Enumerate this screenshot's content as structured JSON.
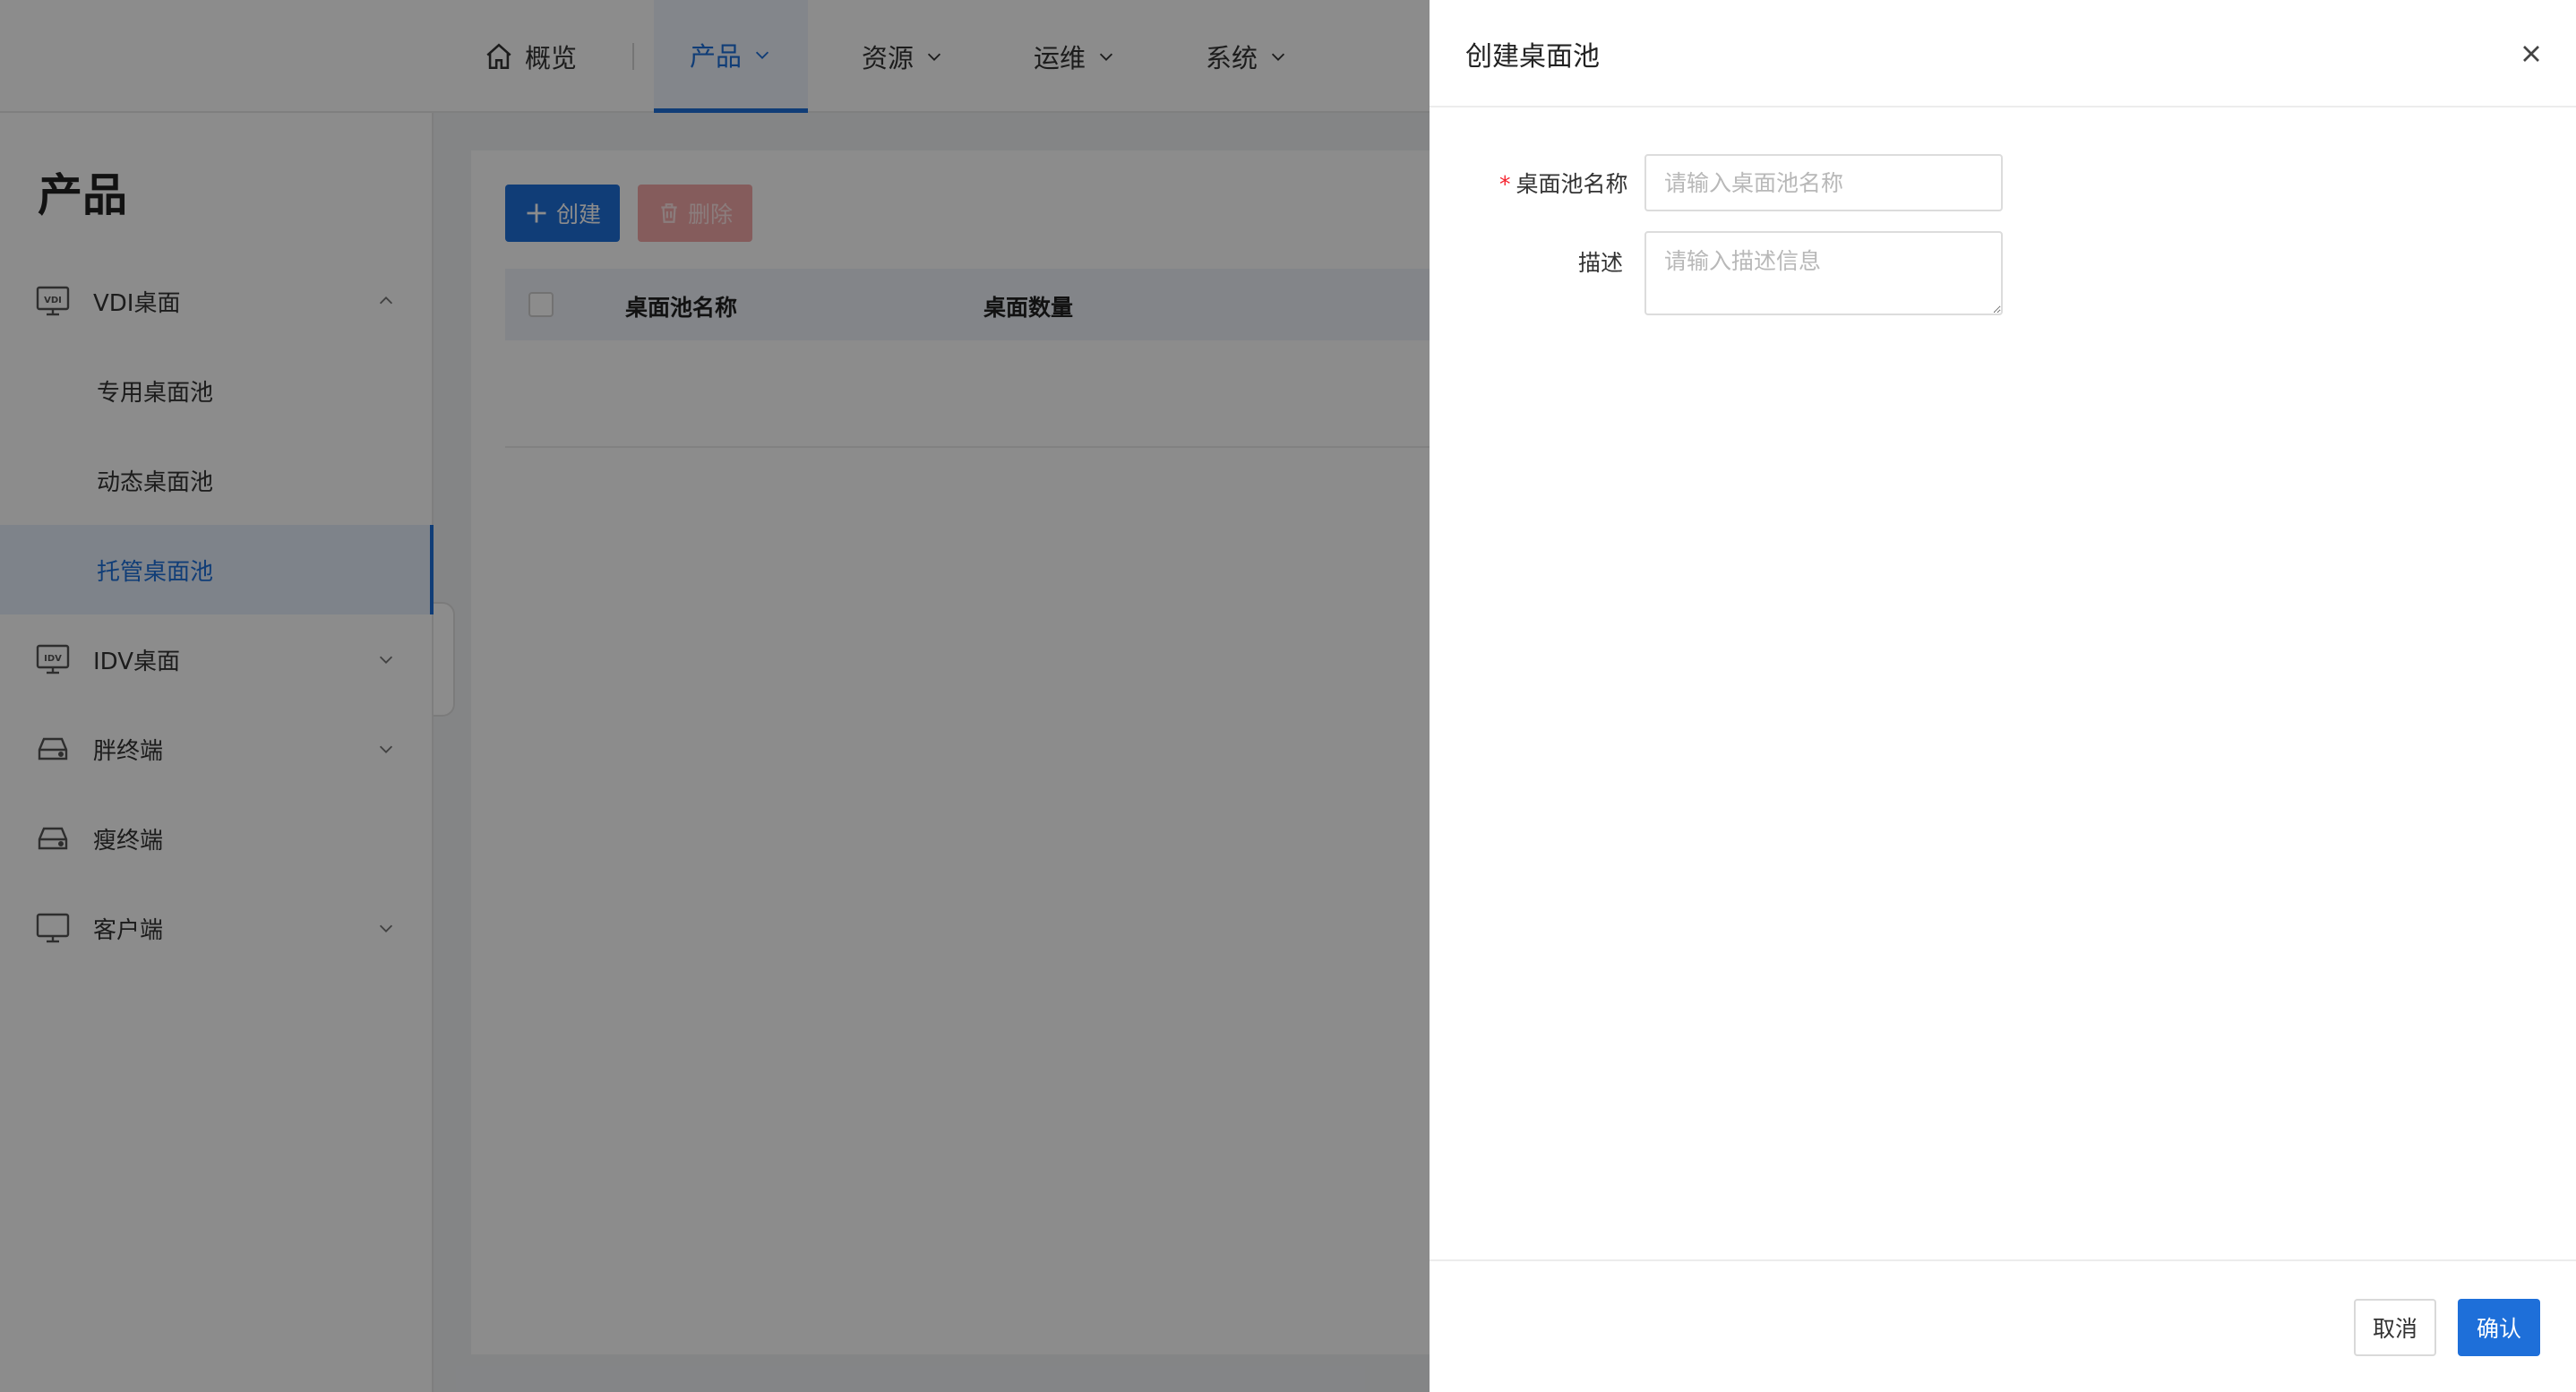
{
  "nav": {
    "overview": "概览",
    "product": "产品",
    "resource": "资源",
    "ops": "运维",
    "system": "系统"
  },
  "sidebar": {
    "title": "产品",
    "items": [
      {
        "label": "VDI桌面",
        "icon": "vdi-monitor-icon",
        "expanded": true
      },
      {
        "label": "专用桌面池"
      },
      {
        "label": "动态桌面池"
      },
      {
        "label": "托管桌面池",
        "selected": true
      },
      {
        "label": "IDV桌面",
        "icon": "idv-monitor-icon"
      },
      {
        "label": "胖终端",
        "icon": "terminal-icon"
      },
      {
        "label": "瘦终端",
        "icon": "terminal-icon"
      },
      {
        "label": "客户端",
        "icon": "monitor-icon"
      }
    ]
  },
  "toolbar": {
    "create": "创建",
    "delete": "删除"
  },
  "table": {
    "columns": [
      "桌面池名称",
      "桌面数量"
    ]
  },
  "drawer": {
    "title": "创建桌面池",
    "name_label": "桌面池名称",
    "name_placeholder": "请输入桌面池名称",
    "desc_label": "描述",
    "desc_placeholder": "请输入描述信息",
    "cancel": "取消",
    "confirm": "确认"
  },
  "colors": {
    "accent": "#1e6fd9",
    "danger": "#f5222d"
  }
}
